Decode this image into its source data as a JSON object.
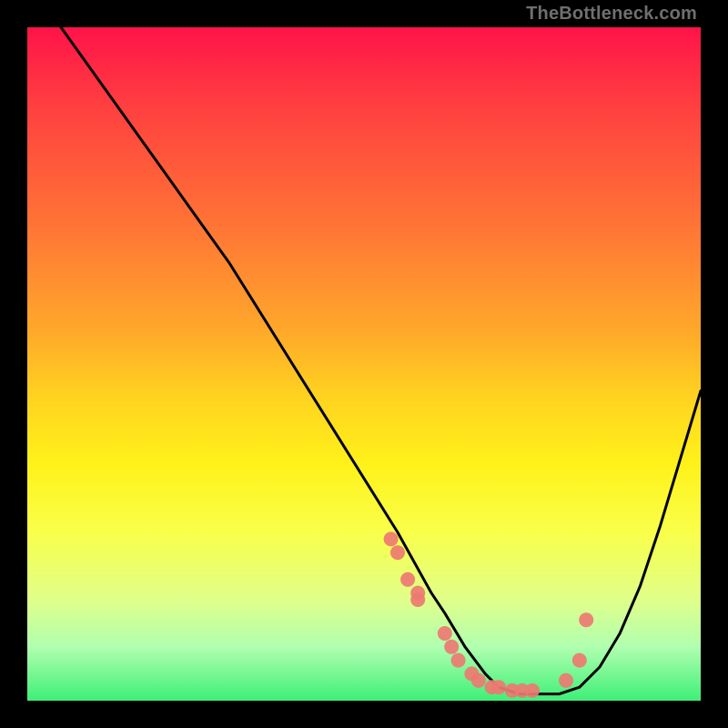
{
  "watermark": "TheBottleneck.com",
  "chart_data": {
    "type": "line",
    "title": "",
    "xlabel": "",
    "ylabel": "",
    "xlim": [
      0,
      100
    ],
    "ylim": [
      0,
      100
    ],
    "grid": false,
    "series": [
      {
        "name": "bottleneck-curve",
        "x": [
          5,
          10,
          15,
          20,
          25,
          30,
          35,
          40,
          45,
          50,
          55,
          60,
          62,
          65,
          68,
          70,
          73,
          76,
          79,
          82,
          85,
          88,
          91,
          94,
          97,
          100
        ],
        "y": [
          100,
          93,
          86,
          79,
          72,
          65,
          57,
          49,
          41,
          33,
          25,
          16,
          13,
          8,
          4,
          2,
          1,
          1,
          1,
          2,
          5,
          10,
          17,
          26,
          36,
          46
        ]
      }
    ],
    "markers": {
      "name": "data-points",
      "x": [
        54,
        55,
        56.5,
        58,
        58,
        62,
        63,
        64,
        66,
        67,
        69,
        70,
        72,
        73.5,
        75,
        80,
        82,
        83
      ],
      "y": [
        24,
        22,
        18,
        16,
        15,
        10,
        8,
        6,
        4,
        3,
        2,
        2,
        1.5,
        1.5,
        1.5,
        3,
        6,
        12
      ]
    },
    "gradient": {
      "direction": "vertical",
      "stops": [
        {
          "y": 100,
          "color": "#ff1349"
        },
        {
          "y": 70,
          "color": "#ff7635"
        },
        {
          "y": 40,
          "color": "#ffd320"
        },
        {
          "y": 15,
          "color": "#f9ff4a"
        },
        {
          "y": 0,
          "color": "#3eef77"
        }
      ]
    }
  }
}
